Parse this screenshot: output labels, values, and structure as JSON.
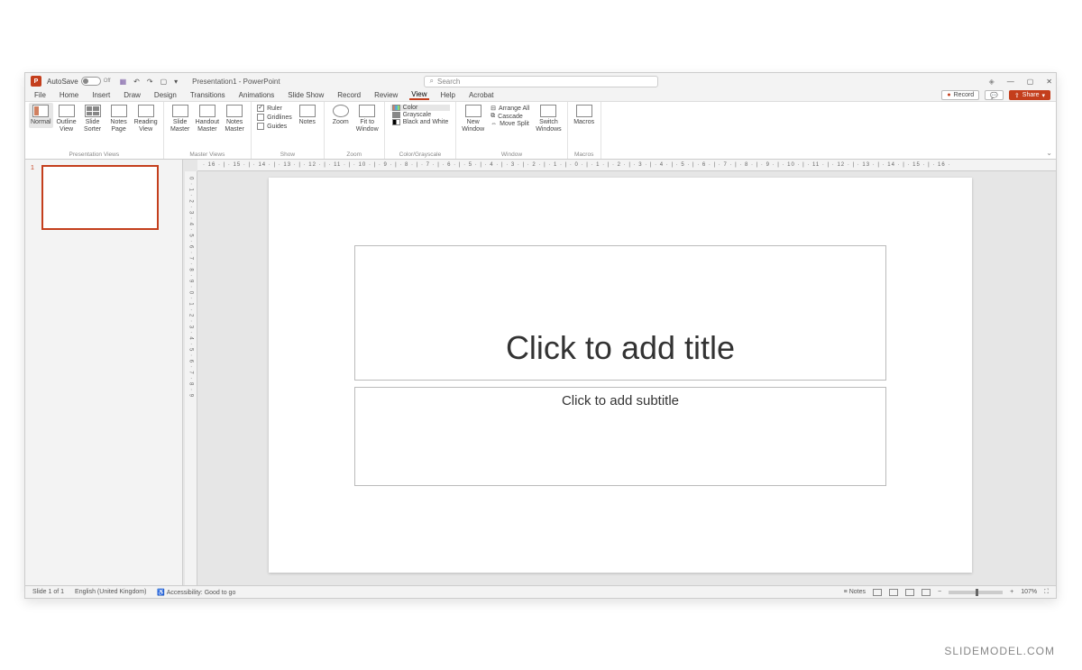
{
  "titlebar": {
    "autosave": "AutoSave",
    "autosave_state": "Off",
    "doc_title": "Presentation1 - PowerPoint",
    "search_placeholder": "Search"
  },
  "tabs": {
    "items": [
      "File",
      "Home",
      "Insert",
      "Draw",
      "Design",
      "Transitions",
      "Animations",
      "Slide Show",
      "Record",
      "Review",
      "View",
      "Help",
      "Acrobat"
    ],
    "active": "View",
    "record": "Record",
    "share": "Share"
  },
  "ribbon": {
    "pres_views": {
      "label": "Presentation Views",
      "normal": "Normal",
      "outline": "Outline\nView",
      "sorter": "Slide\nSorter",
      "notes": "Notes\nPage",
      "reading": "Reading\nView"
    },
    "master_views": {
      "label": "Master Views",
      "slide": "Slide\nMaster",
      "handout": "Handout\nMaster",
      "notes": "Notes\nMaster"
    },
    "show": {
      "label": "Show",
      "ruler": "Ruler",
      "gridlines": "Gridlines",
      "guides": "Guides",
      "notes": "Notes"
    },
    "zoom": {
      "label": "Zoom",
      "zoom": "Zoom",
      "fit": "Fit to\nWindow"
    },
    "color": {
      "label": "Color/Grayscale",
      "color": "Color",
      "grayscale": "Grayscale",
      "bw": "Black and White"
    },
    "window": {
      "label": "Window",
      "new": "New\nWindow",
      "arrange": "Arrange All",
      "cascade": "Cascade",
      "split": "Move Split",
      "switch": "Switch\nWindows"
    },
    "macros": {
      "label": "Macros",
      "macros": "Macros"
    }
  },
  "slide": {
    "title_placeholder": "Click to add title",
    "subtitle_placeholder": "Click to add subtitle",
    "thumb_number": "1"
  },
  "ruler": {
    "h": "· 16 · | · 15 · | · 14 · | · 13 · | · 12 · | · 11 · | · 10 · | · 9 · | · 8 · | · 7 · | · 6 · | · 5 · | · 4 · | · 3 · | · 2 · | · 1 · | · 0 · | · 1 · | · 2 · | · 3 · | · 4 · | · 5 · | · 6 · | · 7 · | · 8 · | · 9 · | · 10 · | · 11 · | · 12 · | · 13 · | · 14 · | · 15 · | · 16 ·",
    "v": "0 · 1 · 2 · 3 · 4 · 5 · 6 · 7 · 8 · 9 · 0 · 1 · 2 · 3 · 4 · 5 · 6 · 7 · 8 · 9"
  },
  "status": {
    "slide": "Slide 1 of 1",
    "lang": "English (United Kingdom)",
    "access": "Accessibility: Good to go",
    "notes": "Notes",
    "zoom": "107%"
  },
  "watermark": "SLIDEMODEL.COM"
}
